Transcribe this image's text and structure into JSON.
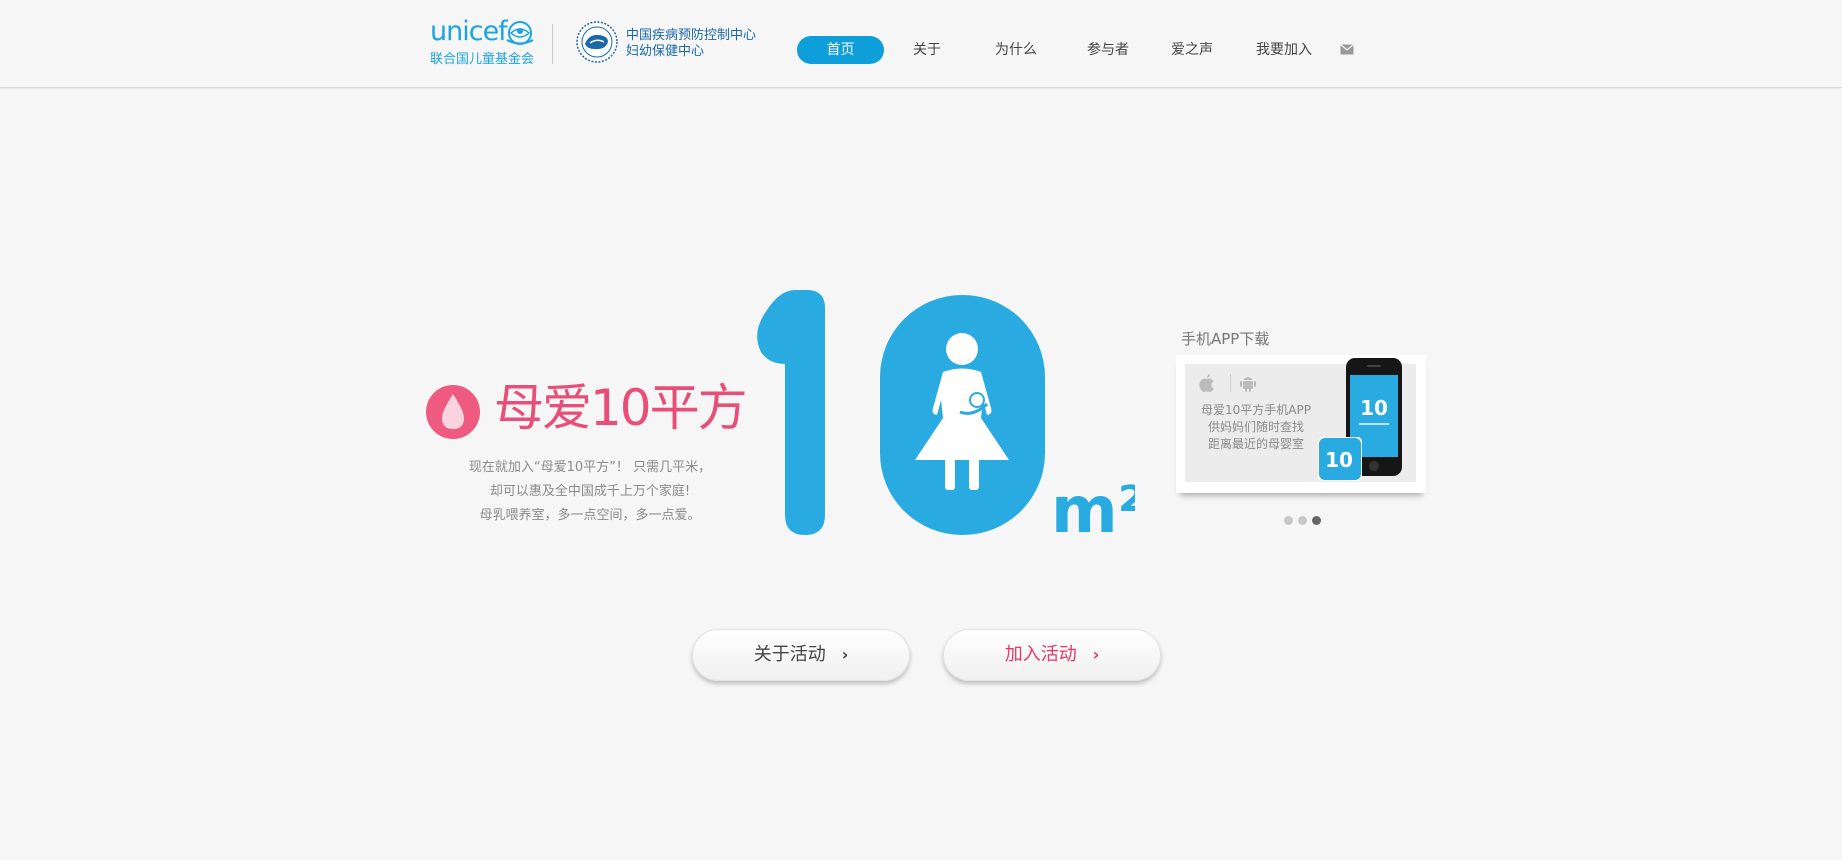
{
  "header": {
    "unicef_word": "unicef",
    "unicef_cn": "联合国儿童基金会",
    "cdc_line1": "中国疾病预防控制中心",
    "cdc_line2": "妇幼保健中心"
  },
  "nav": {
    "items": [
      {
        "label": "首页",
        "active": true
      },
      {
        "label": "关于"
      },
      {
        "label": "为什么"
      },
      {
        "label": "参与者"
      },
      {
        "label": "爱之声"
      },
      {
        "label": "我要加入"
      }
    ],
    "mail_icon": "mail-icon"
  },
  "hero": {
    "title": "母爱10平方",
    "intro": [
      "现在就加入“母爱10平方”！ 只需几平米，",
      "却可以惠及全中国成千上万个家庭!",
      "母乳喂养室，多一点空间，多一点爱。"
    ],
    "big_number": "10",
    "unit": "m²"
  },
  "app": {
    "title": "手机APP下载",
    "desc": [
      "母爱10平方手机APP",
      "供妈妈们随时查找",
      "距离最近的母婴室"
    ],
    "phone_text": "10",
    "badge_text": "10",
    "icons": [
      "apple-icon",
      "android-icon"
    ],
    "carousel_active": 3,
    "carousel_count": 3
  },
  "buttons": {
    "about": "关于活动",
    "join": "加入活动"
  },
  "colors": {
    "brand_blue": "#29abe2",
    "nav_active": "#0e9fdb",
    "brand_pink": "#e94e78"
  }
}
